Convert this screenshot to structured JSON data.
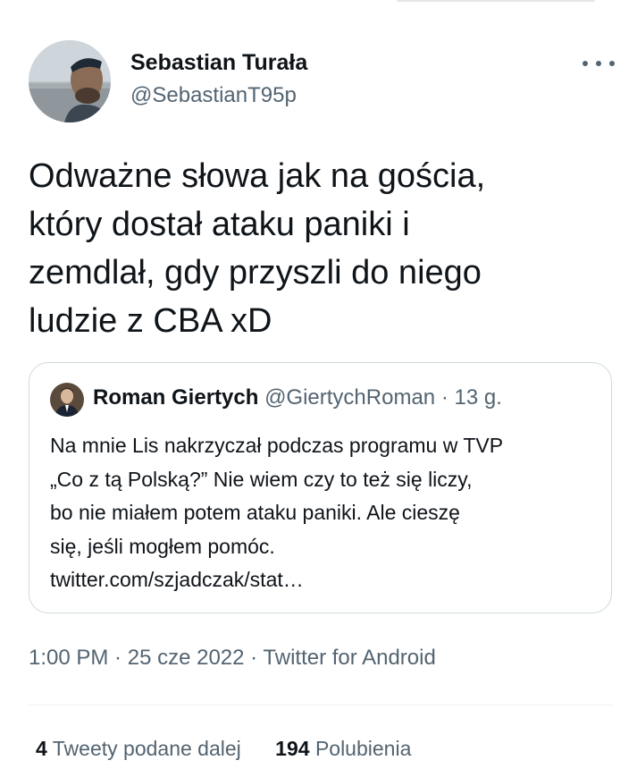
{
  "tweet": {
    "author_name": "Sebastian Turała",
    "author_handle": "@SebastianT95p",
    "text": "Odważne słowa jak na gościa,\nktóry dostał ataku paniki i\nzemdlał, gdy przyszli do niego\nludzie z CBA xD",
    "time": "1:00 PM",
    "date": "25 cze 2022",
    "source": "Twitter for Android",
    "separator": " · "
  },
  "quote": {
    "author_name": "Roman Giertych",
    "author_handle": "@GiertychRoman",
    "separator": " · ",
    "time": "13 g.",
    "text": "Na mnie Lis nakrzyczał podczas programu w TVP\n„Co z tą Polską?” Nie wiem czy to też się liczy,\nbo nie miałem potem ataku paniki. Ale cieszę\nsię, jeśli mogłem pomóc.\ntwitter.com/szjadczak/stat…"
  },
  "stats": {
    "retweets_count": "4",
    "retweets_label": "Tweety podane dalej",
    "likes_count": "194",
    "likes_label": "Polubienia"
  },
  "icons": {
    "more": "more-horizontal-icon"
  },
  "colors": {
    "text_primary": "#0f1419",
    "text_secondary": "#536471",
    "border": "#cfd9de"
  }
}
